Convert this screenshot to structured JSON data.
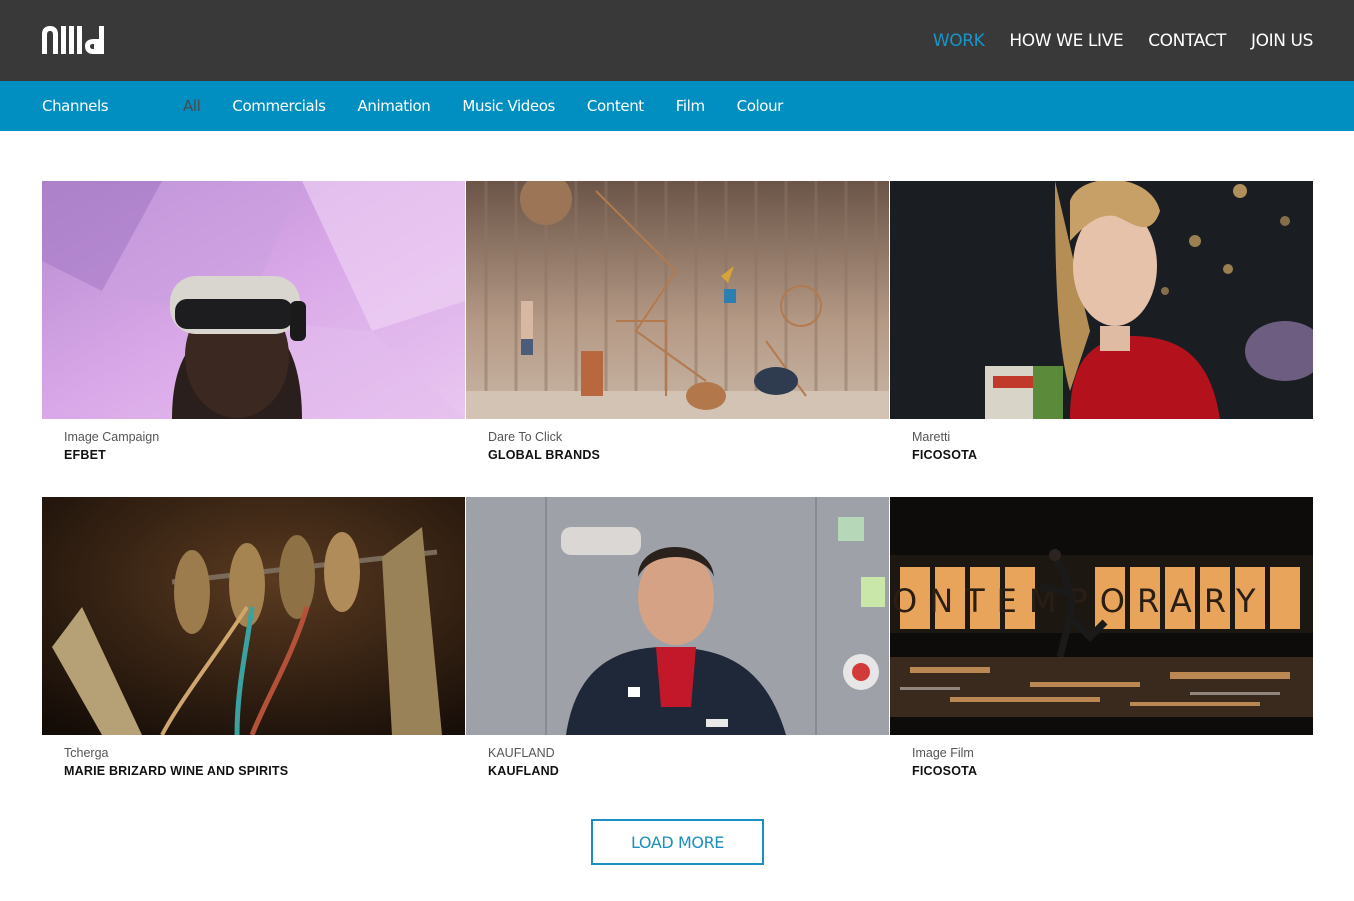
{
  "header": {
    "logo_alt": "nulla",
    "nav": [
      {
        "label": "WORK",
        "active": true
      },
      {
        "label": "HOW WE LIVE",
        "active": false
      },
      {
        "label": "CONTACT",
        "active": false
      },
      {
        "label": "JOIN US",
        "active": false
      }
    ]
  },
  "channels": {
    "label": "Channels",
    "filters": [
      {
        "label": "All",
        "active": true
      },
      {
        "label": "Commercials",
        "active": false
      },
      {
        "label": "Animation",
        "active": false
      },
      {
        "label": "Music Videos",
        "active": false
      },
      {
        "label": "Content",
        "active": false
      },
      {
        "label": "Film",
        "active": false
      },
      {
        "label": "Colour",
        "active": false
      }
    ]
  },
  "projects": [
    {
      "subtitle": "Image Campaign",
      "client": "EFBET",
      "image": "vr-headset-photo"
    },
    {
      "subtitle": "Dare To Click",
      "client": "GLOBAL BRANDS",
      "image": "stage-installation-photo"
    },
    {
      "subtitle": "Maretti",
      "client": "FICOSOTA",
      "image": "woman-eating-chips-photo"
    },
    {
      "subtitle": "Tcherga",
      "client": "MARIE BRIZARD WINE AND SPIRITS",
      "image": "spools-photo"
    },
    {
      "subtitle": "KAUFLAND",
      "client": "KAUFLAND",
      "image": "man-in-jacket-photo"
    },
    {
      "subtitle": "Image Film",
      "client": "FICOSOTA",
      "image": "dancer-stage-photo"
    }
  ],
  "thumb_overlay": {
    "banner_text": "ONTEMPORARY"
  },
  "load_more": {
    "label": "LOAD MORE"
  },
  "colors": {
    "topbar": "#393939",
    "channelbar": "#008fc0",
    "accent": "#1696c9"
  }
}
